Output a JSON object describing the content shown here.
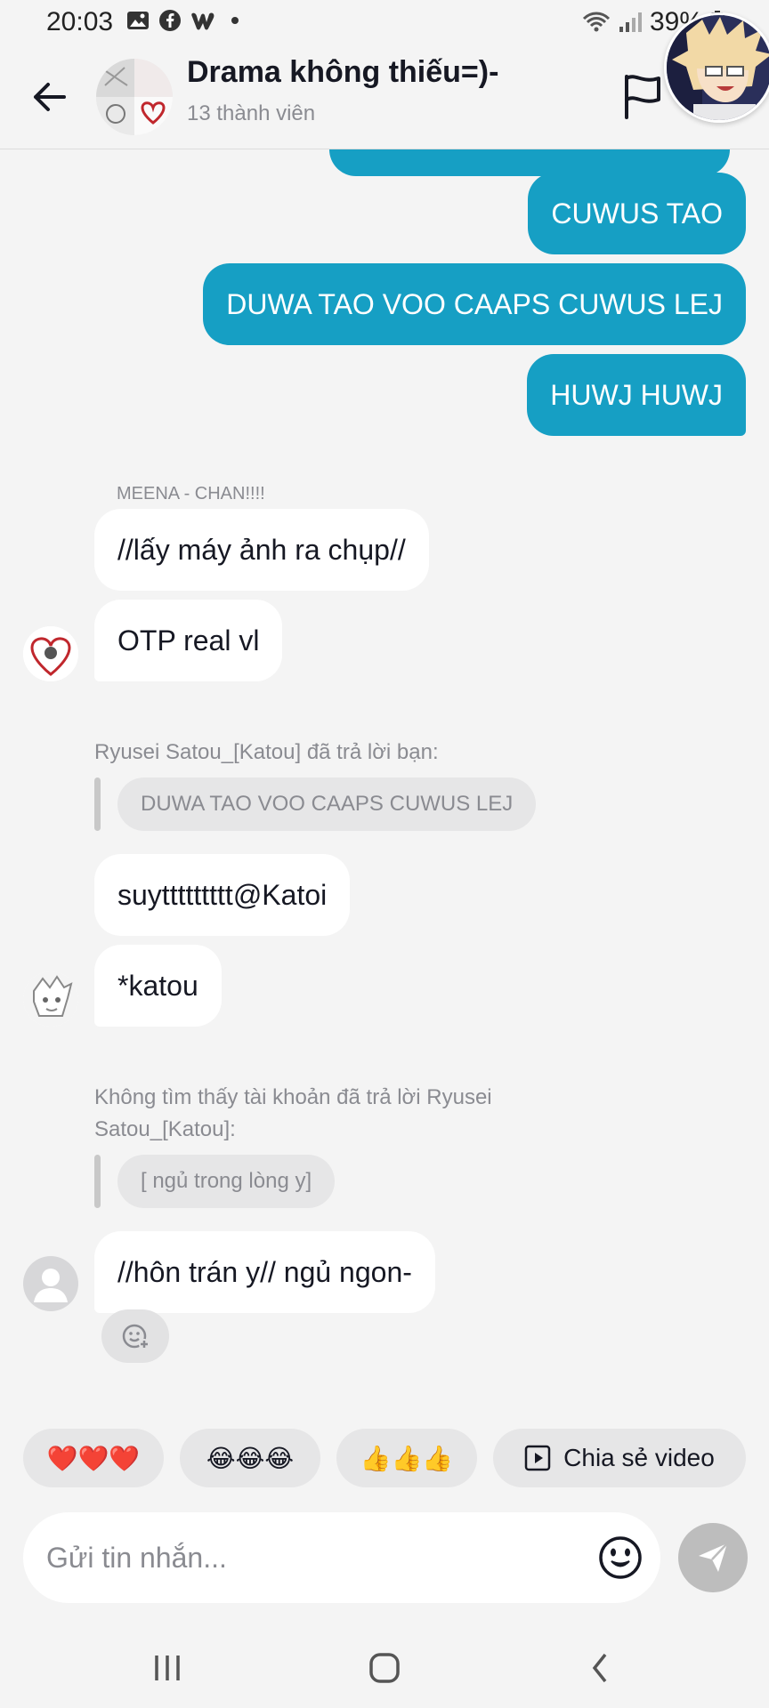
{
  "status_bar": {
    "time": "20:03",
    "battery": "39%"
  },
  "header": {
    "group_name": "Drama không thiếu=)-",
    "members": "13 thành viên"
  },
  "messages_out": [
    {
      "text": "CUWUS TAO"
    },
    {
      "text": "DUWA TAO VOO CAAPS CUWUS LEJ"
    },
    {
      "text": "HUWJ HUWJ"
    }
  ],
  "block1": {
    "sender": "MEENA - CHAN!!!!",
    "messages": [
      "//lấy máy ảnh ra chụp//",
      "OTP real vl"
    ]
  },
  "block2": {
    "reply_note": "Ryusei Satou_[Katou] đã trả lời bạn:",
    "quote": "DUWA TAO VOO CAAPS CUWUS LEJ",
    "messages": [
      "suyttttttttt@Katoi",
      "*katou"
    ]
  },
  "block3": {
    "reply_note": "Không tìm thấy tài khoản đã trả lời Ryusei Satou_[Katou]:",
    "quote": "[ ngủ trong lòng y]",
    "messages": [
      "//hôn trán y// ngủ ngon-"
    ]
  },
  "quick_replies": {
    "hearts": "❤️❤️❤️",
    "laughs": "😂😂😂",
    "thumbs": "👍👍👍",
    "share_video": "Chia sẻ video"
  },
  "input": {
    "placeholder": "Gửi tin nhắn..."
  },
  "colors": {
    "outgoing_bubble": "#169fc4",
    "incoming_bubble": "#ffffff",
    "background": "#f4f4f4"
  }
}
